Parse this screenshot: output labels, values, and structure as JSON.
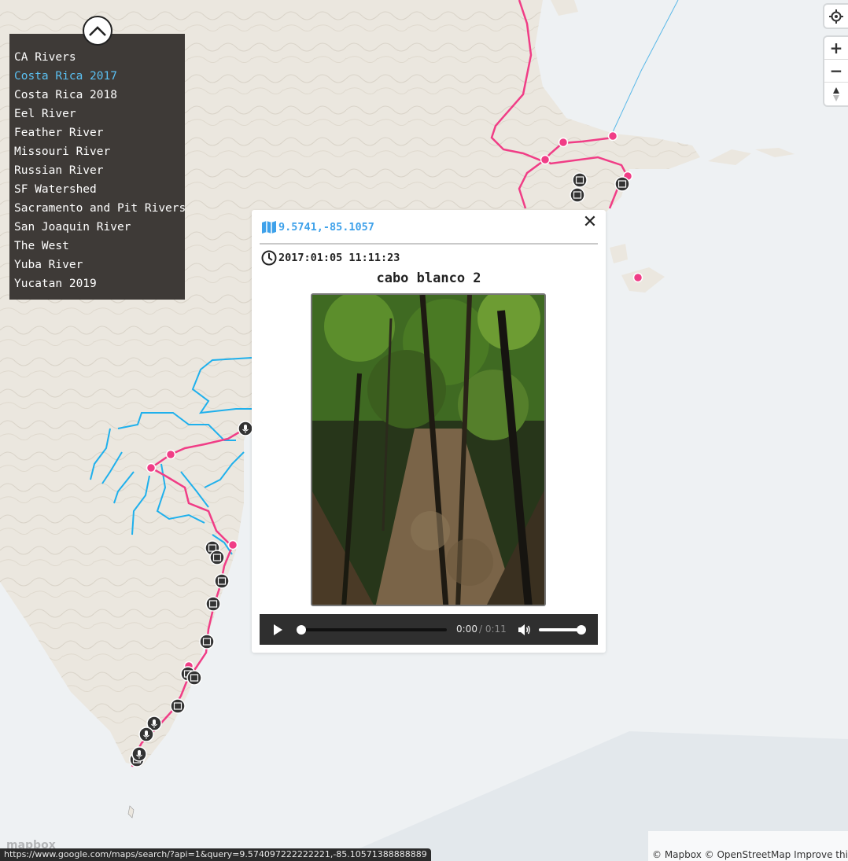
{
  "map": {
    "colors": {
      "water": "#eef1f3",
      "land": "#ebe7df",
      "route": "#f03d86",
      "river": "#1fb0ec",
      "marker": "#333333"
    }
  },
  "layer_menu": {
    "items": [
      {
        "label": "CA Rivers",
        "active": false
      },
      {
        "label": "Costa Rica 2017",
        "active": true
      },
      {
        "label": "Costa Rica 2018",
        "active": false
      },
      {
        "label": "Eel River",
        "active": false
      },
      {
        "label": "Feather River",
        "active": false
      },
      {
        "label": "Missouri River",
        "active": false
      },
      {
        "label": "Russian River",
        "active": false
      },
      {
        "label": "SF Watershed",
        "active": false
      },
      {
        "label": "Sacramento and Pit Rivers",
        "active": false
      },
      {
        "label": "San Joaquin River",
        "active": false
      },
      {
        "label": "The West",
        "active": false
      },
      {
        "label": "Yuba River",
        "active": false
      },
      {
        "label": "Yucatan 2019",
        "active": false
      }
    ]
  },
  "controls": {
    "zoom_in": "+",
    "zoom_out": "−"
  },
  "popup": {
    "coordinates": "9.5741,-85.1057",
    "datetime": "2017:01:05 11:11:23",
    "title": "cabo blanco 2",
    "close_label": "✕",
    "audio": {
      "current_time": "0:00",
      "duration": "/ 0:11",
      "progress": 0,
      "volume": 1
    }
  },
  "footer": {
    "attribution": "© Mapbox © OpenStreetMap Improve this map",
    "status_url": "https://www.google.com/maps/search/?api=1&query=9.574097222222221,-85.10571388888889",
    "logo": "mapbox"
  }
}
